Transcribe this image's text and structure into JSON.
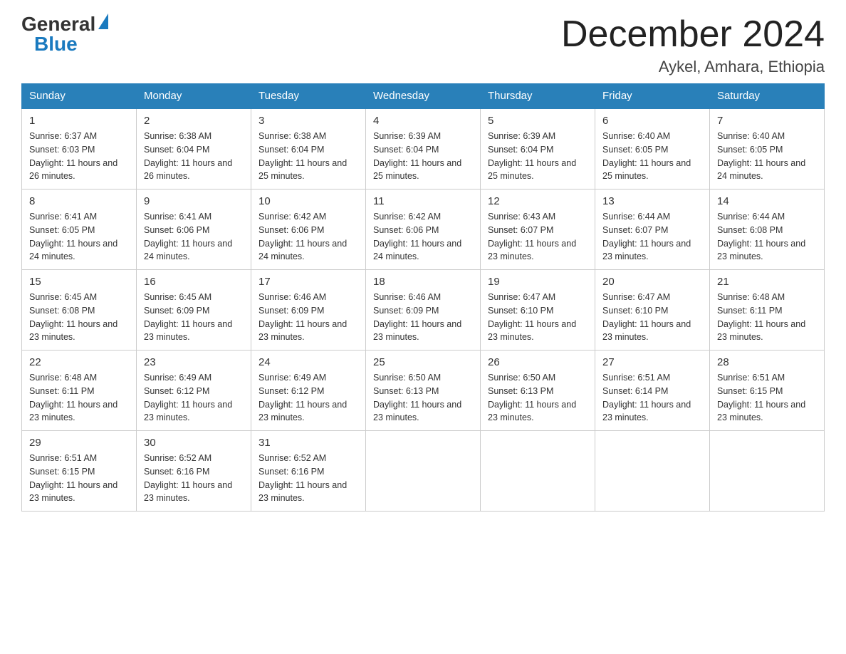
{
  "header": {
    "logo_general": "General",
    "logo_blue": "Blue",
    "month_title": "December 2024",
    "location": "Aykel, Amhara, Ethiopia"
  },
  "days_of_week": [
    "Sunday",
    "Monday",
    "Tuesday",
    "Wednesday",
    "Thursday",
    "Friday",
    "Saturday"
  ],
  "weeks": [
    [
      {
        "day": "1",
        "sunrise": "6:37 AM",
        "sunset": "6:03 PM",
        "daylight": "11 hours and 26 minutes."
      },
      {
        "day": "2",
        "sunrise": "6:38 AM",
        "sunset": "6:04 PM",
        "daylight": "11 hours and 26 minutes."
      },
      {
        "day": "3",
        "sunrise": "6:38 AM",
        "sunset": "6:04 PM",
        "daylight": "11 hours and 25 minutes."
      },
      {
        "day": "4",
        "sunrise": "6:39 AM",
        "sunset": "6:04 PM",
        "daylight": "11 hours and 25 minutes."
      },
      {
        "day": "5",
        "sunrise": "6:39 AM",
        "sunset": "6:04 PM",
        "daylight": "11 hours and 25 minutes."
      },
      {
        "day": "6",
        "sunrise": "6:40 AM",
        "sunset": "6:05 PM",
        "daylight": "11 hours and 25 minutes."
      },
      {
        "day": "7",
        "sunrise": "6:40 AM",
        "sunset": "6:05 PM",
        "daylight": "11 hours and 24 minutes."
      }
    ],
    [
      {
        "day": "8",
        "sunrise": "6:41 AM",
        "sunset": "6:05 PM",
        "daylight": "11 hours and 24 minutes."
      },
      {
        "day": "9",
        "sunrise": "6:41 AM",
        "sunset": "6:06 PM",
        "daylight": "11 hours and 24 minutes."
      },
      {
        "day": "10",
        "sunrise": "6:42 AM",
        "sunset": "6:06 PM",
        "daylight": "11 hours and 24 minutes."
      },
      {
        "day": "11",
        "sunrise": "6:42 AM",
        "sunset": "6:06 PM",
        "daylight": "11 hours and 24 minutes."
      },
      {
        "day": "12",
        "sunrise": "6:43 AM",
        "sunset": "6:07 PM",
        "daylight": "11 hours and 23 minutes."
      },
      {
        "day": "13",
        "sunrise": "6:44 AM",
        "sunset": "6:07 PM",
        "daylight": "11 hours and 23 minutes."
      },
      {
        "day": "14",
        "sunrise": "6:44 AM",
        "sunset": "6:08 PM",
        "daylight": "11 hours and 23 minutes."
      }
    ],
    [
      {
        "day": "15",
        "sunrise": "6:45 AM",
        "sunset": "6:08 PM",
        "daylight": "11 hours and 23 minutes."
      },
      {
        "day": "16",
        "sunrise": "6:45 AM",
        "sunset": "6:09 PM",
        "daylight": "11 hours and 23 minutes."
      },
      {
        "day": "17",
        "sunrise": "6:46 AM",
        "sunset": "6:09 PM",
        "daylight": "11 hours and 23 minutes."
      },
      {
        "day": "18",
        "sunrise": "6:46 AM",
        "sunset": "6:09 PM",
        "daylight": "11 hours and 23 minutes."
      },
      {
        "day": "19",
        "sunrise": "6:47 AM",
        "sunset": "6:10 PM",
        "daylight": "11 hours and 23 minutes."
      },
      {
        "day": "20",
        "sunrise": "6:47 AM",
        "sunset": "6:10 PM",
        "daylight": "11 hours and 23 minutes."
      },
      {
        "day": "21",
        "sunrise": "6:48 AM",
        "sunset": "6:11 PM",
        "daylight": "11 hours and 23 minutes."
      }
    ],
    [
      {
        "day": "22",
        "sunrise": "6:48 AM",
        "sunset": "6:11 PM",
        "daylight": "11 hours and 23 minutes."
      },
      {
        "day": "23",
        "sunrise": "6:49 AM",
        "sunset": "6:12 PM",
        "daylight": "11 hours and 23 minutes."
      },
      {
        "day": "24",
        "sunrise": "6:49 AM",
        "sunset": "6:12 PM",
        "daylight": "11 hours and 23 minutes."
      },
      {
        "day": "25",
        "sunrise": "6:50 AM",
        "sunset": "6:13 PM",
        "daylight": "11 hours and 23 minutes."
      },
      {
        "day": "26",
        "sunrise": "6:50 AM",
        "sunset": "6:13 PM",
        "daylight": "11 hours and 23 minutes."
      },
      {
        "day": "27",
        "sunrise": "6:51 AM",
        "sunset": "6:14 PM",
        "daylight": "11 hours and 23 minutes."
      },
      {
        "day": "28",
        "sunrise": "6:51 AM",
        "sunset": "6:15 PM",
        "daylight": "11 hours and 23 minutes."
      }
    ],
    [
      {
        "day": "29",
        "sunrise": "6:51 AM",
        "sunset": "6:15 PM",
        "daylight": "11 hours and 23 minutes."
      },
      {
        "day": "30",
        "sunrise": "6:52 AM",
        "sunset": "6:16 PM",
        "daylight": "11 hours and 23 minutes."
      },
      {
        "day": "31",
        "sunrise": "6:52 AM",
        "sunset": "6:16 PM",
        "daylight": "11 hours and 23 minutes."
      },
      null,
      null,
      null,
      null
    ]
  ]
}
